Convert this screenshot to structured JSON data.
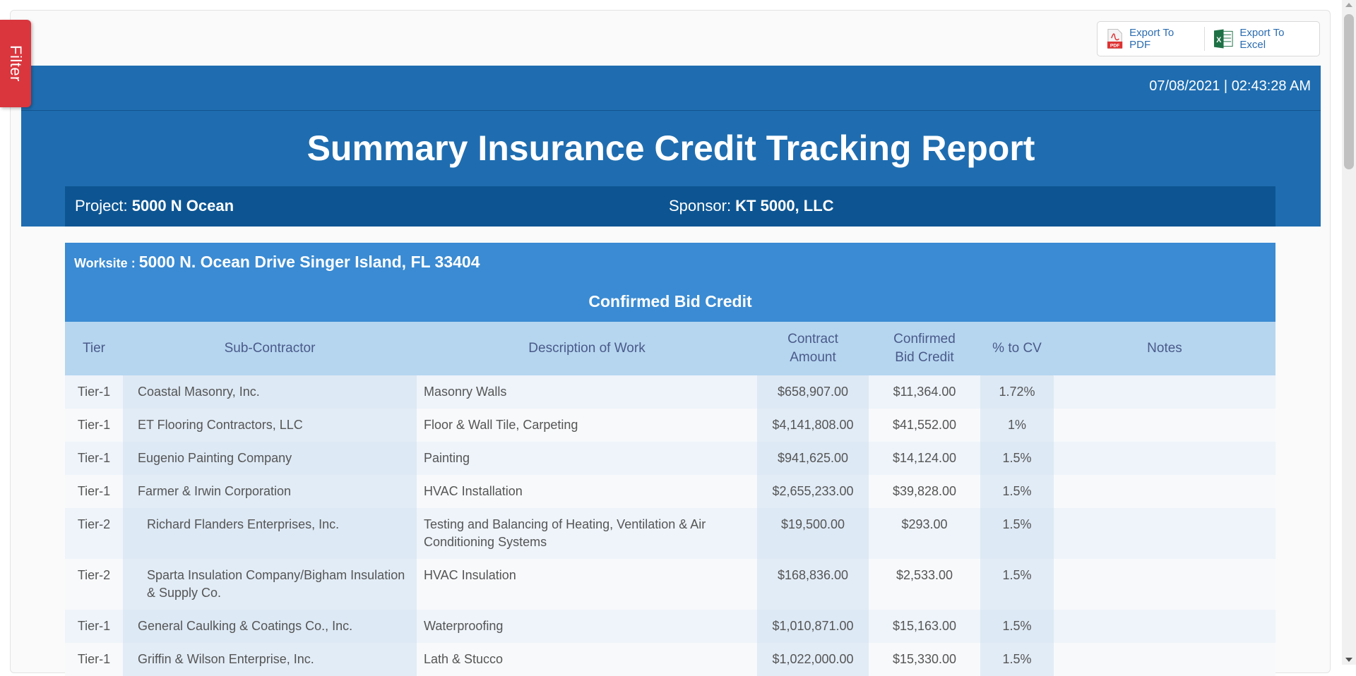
{
  "filter": {
    "label": "Filter"
  },
  "export": {
    "pdf_label": "Export To PDF",
    "excel_label": "Export To Excel"
  },
  "header": {
    "datetime": "07/08/2021 | 02:43:28 AM",
    "title": "Summary Insurance Credit Tracking Report",
    "project_label": "Project: ",
    "project_value": "5000 N Ocean",
    "sponsor_label": "Sponsor: ",
    "sponsor_value": "KT 5000, LLC"
  },
  "worksite": {
    "label": "Worksite : ",
    "value": "5000 N. Ocean Drive Singer Island, FL 33404",
    "section_title": "Confirmed Bid Credit"
  },
  "table": {
    "headers": {
      "tier": "Tier",
      "sub": "Sub-Contractor",
      "desc": "Description of Work",
      "contract_1": "Contract",
      "contract_2": "Amount",
      "credit_1": "Confirmed",
      "credit_2": "Bid Credit",
      "pct": "% to CV",
      "notes": "Notes"
    },
    "rows": [
      {
        "tier": "Tier-1",
        "sub": "Coastal Masonry, Inc.",
        "desc": "Masonry Walls",
        "contract": "$658,907.00",
        "credit": "$11,364.00",
        "pct": "1.72%",
        "notes": ""
      },
      {
        "tier": "Tier-1",
        "sub": "ET Flooring Contractors, LLC",
        "desc": "Floor & Wall Tile, Carpeting",
        "contract": "$4,141,808.00",
        "credit": "$41,552.00",
        "pct": "1%",
        "notes": ""
      },
      {
        "tier": "Tier-1",
        "sub": "Eugenio Painting Company",
        "desc": "Painting",
        "contract": "$941,625.00",
        "credit": "$14,124.00",
        "pct": "1.5%",
        "notes": ""
      },
      {
        "tier": "Tier-1",
        "sub": "Farmer & Irwin Corporation",
        "desc": "HVAC Installation",
        "contract": "$2,655,233.00",
        "credit": "$39,828.00",
        "pct": "1.5%",
        "notes": ""
      },
      {
        "tier": "Tier-2",
        "sub": "Richard Flanders Enterprises, Inc.",
        "desc": "Testing and Balancing of Heating, Ventilation & Air Conditioning Systems",
        "contract": "$19,500.00",
        "credit": "$293.00",
        "pct": "1.5%",
        "notes": ""
      },
      {
        "tier": "Tier-2",
        "sub": "Sparta Insulation Company/Bigham Insulation & Supply Co.",
        "desc": "HVAC Insulation",
        "contract": "$168,836.00",
        "credit": "$2,533.00",
        "pct": "1.5%",
        "notes": ""
      },
      {
        "tier": "Tier-1",
        "sub": "General Caulking & Coatings Co., Inc.",
        "desc": "Waterproofing",
        "contract": "$1,010,871.00",
        "credit": "$15,163.00",
        "pct": "1.5%",
        "notes": ""
      },
      {
        "tier": "Tier-1",
        "sub": "Griffin & Wilson Enterprise, Inc.",
        "desc": "Lath & Stucco",
        "contract": "$1,022,000.00",
        "credit": "$15,330.00",
        "pct": "1.5%",
        "notes": ""
      }
    ]
  }
}
